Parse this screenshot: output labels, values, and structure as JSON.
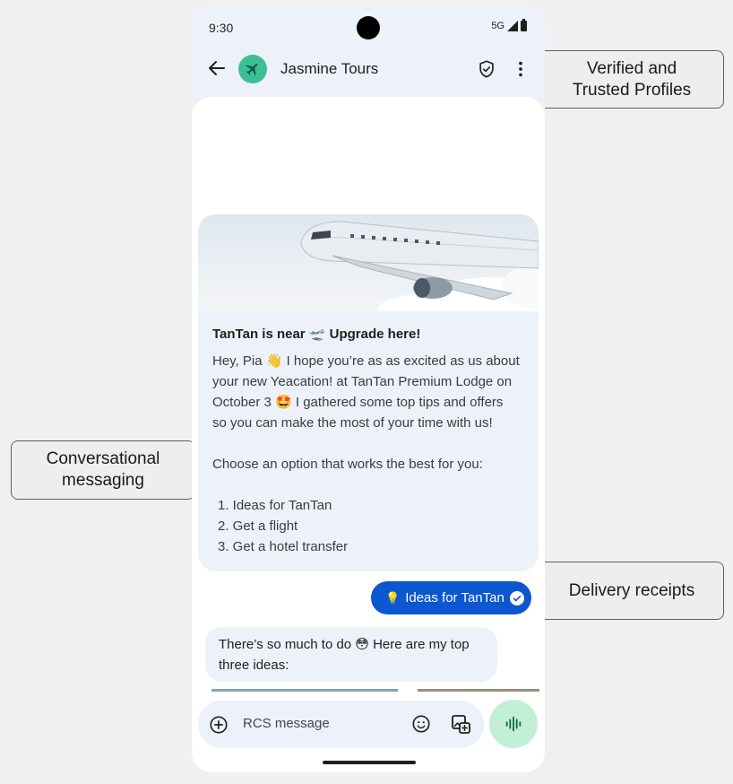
{
  "status": {
    "time": "9:30",
    "network": "5G"
  },
  "header": {
    "title": "Jasmine Tours"
  },
  "card": {
    "title": "TanTan is near 🛫 Upgrade here!",
    "body_lines": [
      "Hey, Pia 👋 I hope you’re as as excited as us about",
      "your new Yeacation! at TanTan Premium Lodge on",
      "October 3 🤩 I gathered some top tips and offers",
      "so you can make the most of your time with us!"
    ],
    "prompt": "Choose an option that works the best for you:",
    "options": [
      "1. Ideas for TanTan",
      "2. Get a flight",
      "3. Get a hotel transfer"
    ]
  },
  "sent_message": {
    "icon": "💡",
    "text": "Ideas for TanTan"
  },
  "received_message": {
    "lines": [
      "There’s so much to do 😳 Here are my top",
      "three ideas:"
    ]
  },
  "composer": {
    "placeholder": "RCS message"
  },
  "callouts": {
    "verified": [
      "Verified and",
      "Trusted Profiles"
    ],
    "conversational": [
      "Conversational",
      "messaging"
    ],
    "delivery": "Delivery receipts"
  },
  "colors": {
    "sent_bubble": "#0b57d0",
    "avatar": "#3dbf95",
    "mic_button": "#c2f0d4",
    "surface": "#edf1f9"
  }
}
